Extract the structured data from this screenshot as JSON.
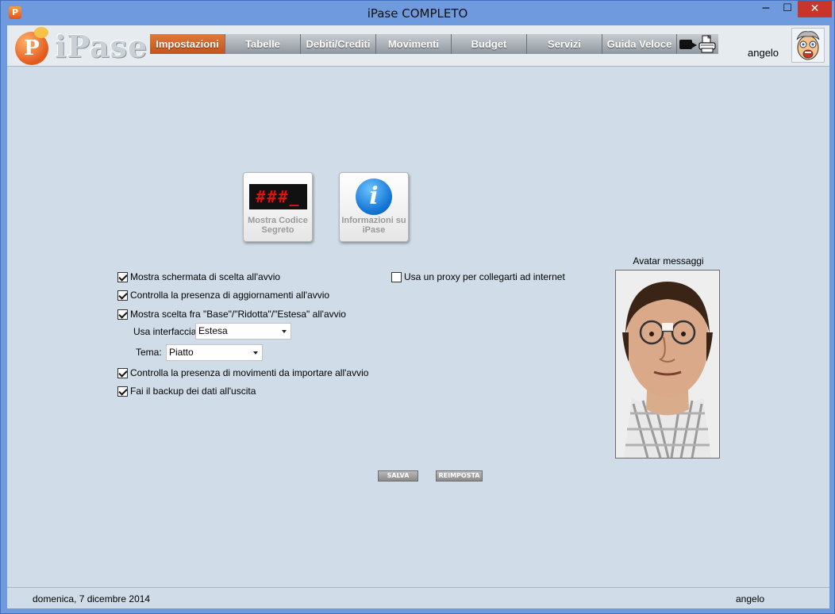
{
  "window": {
    "title": "iPase COMPLETO",
    "app_icon": "P",
    "minimize": "─",
    "maximize": "☐",
    "close": "✕"
  },
  "logo": {
    "mark": "P",
    "text": "iPase"
  },
  "tabs": [
    {
      "label": "Impostazioni",
      "active": true
    },
    {
      "label": "Tabelle",
      "active": false
    },
    {
      "label": "Debiti/Crediti",
      "active": false
    },
    {
      "label": "Movimenti",
      "active": false
    },
    {
      "label": "Budget",
      "active": false
    },
    {
      "label": "Servizi",
      "active": false
    },
    {
      "label": "Guida Veloce",
      "active": false
    }
  ],
  "user": {
    "name": "angelo"
  },
  "buttons": {
    "codice": {
      "display": "###_",
      "label": "Mostra Codice Segreto"
    },
    "info": {
      "glyph": "i",
      "label": "Informazioni su iPase"
    }
  },
  "options": [
    {
      "label": "Mostra schermata di scelta all'avvio",
      "checked": true
    },
    {
      "label": "Controlla la presenza di aggiornamenti all'avvio",
      "checked": true
    },
    {
      "label": "Mostra scelta fra \"Base\"/\"Ridotta\"/\"Estesa\" all'avvio",
      "checked": true
    },
    {
      "label": "Controlla la presenza di movimenti da importare all'avvio",
      "checked": true
    },
    {
      "label": "Fai il backup dei dati all'uscita",
      "checked": true
    }
  ],
  "proxy": {
    "label": "Usa un proxy per collegarti ad internet",
    "checked": false
  },
  "interfaccia": {
    "label": "Usa interfaccia",
    "value": "Estesa"
  },
  "tema": {
    "label": "Tema:",
    "value": "Piatto"
  },
  "avatar": {
    "caption": "Avatar messaggi"
  },
  "actions": {
    "salva": "SALVA",
    "reimposta": "REIMPOSTA"
  },
  "status": {
    "date": "domenica, 7 dicembre 2014",
    "user": "angelo"
  },
  "colors": {
    "accent_tab": "#d0632a",
    "window_frame": "#6f9ade",
    "client_bg": "#d0dce7",
    "close_button": "#c7352b"
  }
}
